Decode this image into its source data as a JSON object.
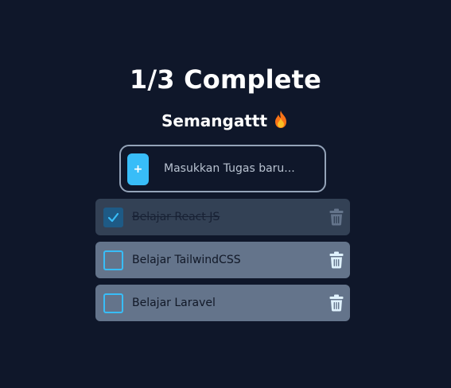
{
  "header": {
    "progress_text": "1/3 Complete",
    "subtitle": "Semangattt"
  },
  "add_task": {
    "button_label": "+",
    "placeholder": "Masukkan Tugas baru...",
    "value": ""
  },
  "tasks": [
    {
      "label": "Belajar React JS",
      "completed": true
    },
    {
      "label": "Belajar TailwindCSS",
      "completed": false
    },
    {
      "label": "Belajar Laravel",
      "completed": false
    }
  ],
  "icons": {
    "subtitle_icon": "fire-icon",
    "checkbox_checked_icon": "check-icon",
    "delete_icon": "trash-icon"
  },
  "colors": {
    "background": "#0f172a",
    "accent": "#38bdf8",
    "task_pending_bg": "#64748b",
    "task_done_bg": "#334155",
    "trash_pending": "#e0f2fe",
    "trash_done": "#64748b"
  }
}
